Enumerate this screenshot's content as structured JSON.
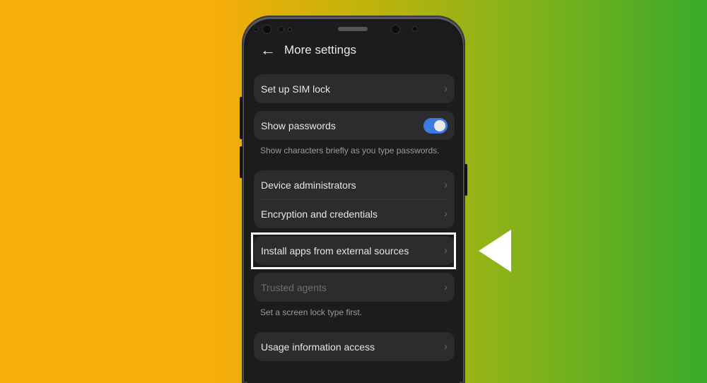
{
  "background": {
    "left_color": "#f8ae0a",
    "right_color": "#3aaa2a"
  },
  "header": {
    "back_icon": "arrow-left-icon",
    "title": "More settings"
  },
  "groups": [
    {
      "items": [
        {
          "label": "Set up SIM lock",
          "type": "chevron"
        }
      ]
    },
    {
      "items": [
        {
          "label": "Show passwords",
          "type": "toggle",
          "on": true
        }
      ],
      "note": "Show characters briefly as you type passwords."
    },
    {
      "items": [
        {
          "label": "Device administrators",
          "type": "chevron"
        },
        {
          "label": "Encryption and credentials",
          "type": "chevron"
        }
      ]
    },
    {
      "items": [
        {
          "label": "Install apps from external sources",
          "type": "chevron",
          "highlighted": true
        }
      ]
    },
    {
      "items": [
        {
          "label": "Trusted agents",
          "type": "chevron",
          "disabled": true
        }
      ],
      "note": "Set a screen lock type first."
    },
    {
      "items": [
        {
          "label": "Usage information access",
          "type": "chevron"
        }
      ]
    }
  ],
  "chevron_glyph": "›",
  "accent": "#3f7ae0",
  "highlight_color": "#ffffff"
}
